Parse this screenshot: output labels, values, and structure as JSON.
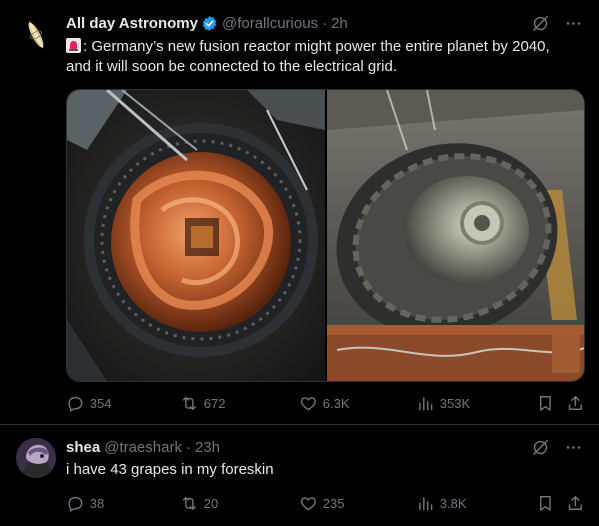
{
  "posts": [
    {
      "author_name": "All day Astronomy",
      "handle": "@forallcurious",
      "separator": "·",
      "time": "2h",
      "text_lines": [
        ": Germany’s new fusion reactor might power the entire planet by 2040,",
        "and it will soon be connected to the electrical grid."
      ],
      "verified": true,
      "stats": {
        "replies": "354",
        "reposts": "672",
        "likes": "6.3K",
        "views": "353K"
      }
    },
    {
      "author_name": "shea",
      "handle": "@traeshark",
      "separator": "·",
      "time": "23h",
      "text_lines": [
        "i have 43 grapes in my foreskin"
      ],
      "verified": false,
      "stats": {
        "replies": "38",
        "reposts": "20",
        "likes": "235",
        "views": "3.8K"
      }
    }
  ],
  "icons": {
    "grok": "grok-icon",
    "more": "more-icon",
    "reply": "reply-icon",
    "repost": "repost-icon",
    "like": "like-icon",
    "views": "views-icon",
    "bookmark": "bookmark-icon",
    "share": "share-icon"
  },
  "colors": {
    "background": "#000000",
    "text": "#e7e9ea",
    "muted": "#71767b",
    "verified": "#1d9bf0",
    "border": "#2f3336"
  }
}
